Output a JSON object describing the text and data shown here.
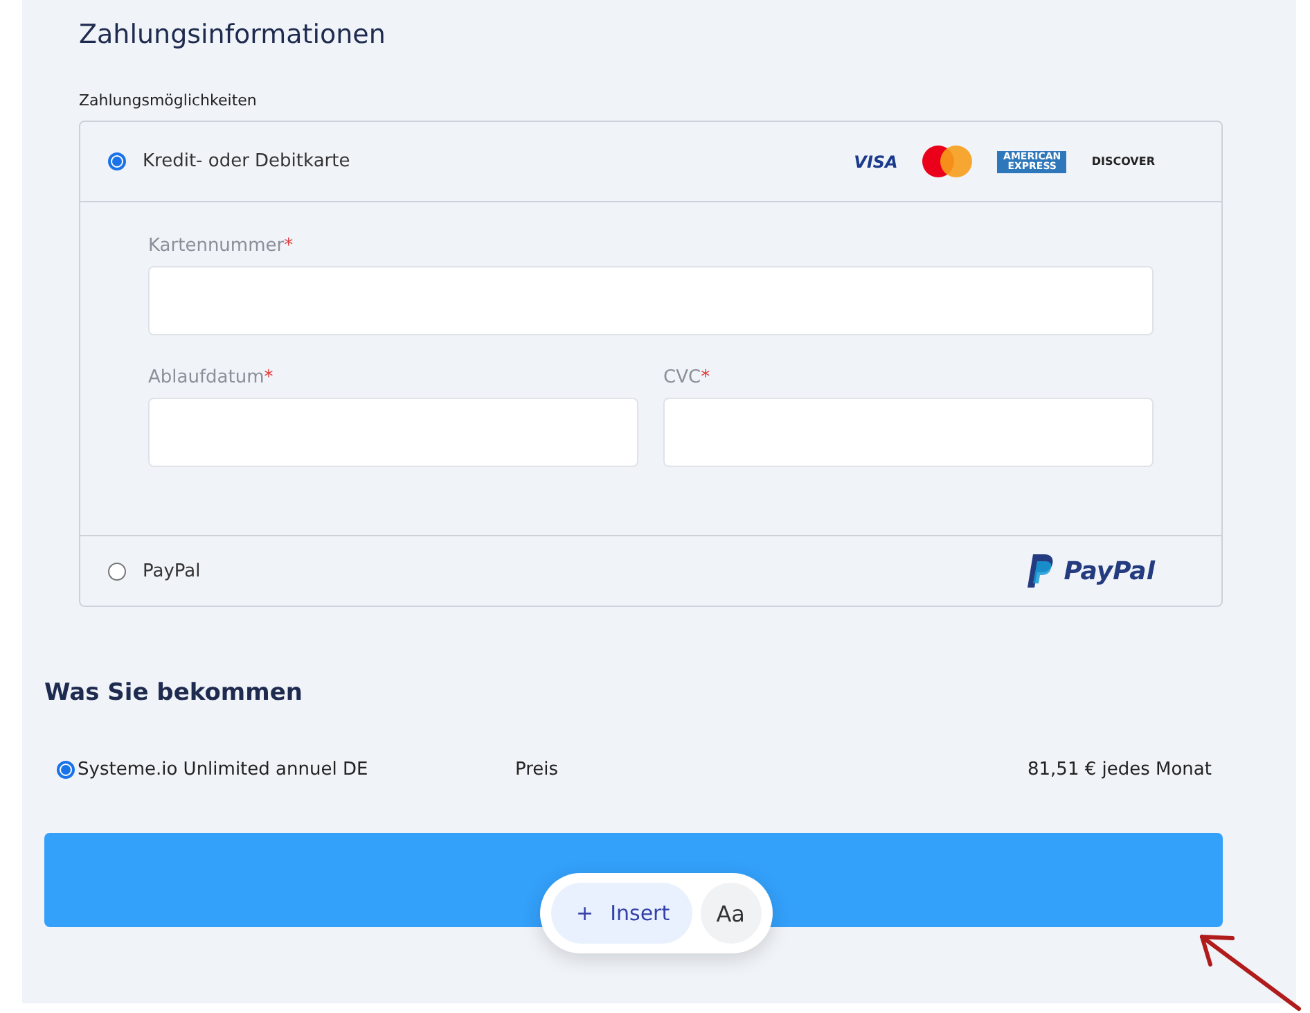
{
  "title": "Zahlungsinformationen",
  "payment_options_label": "Zahlungsmöglichkeiten",
  "payment_methods": [
    {
      "kind": "card",
      "label": "Kredit- oder Debitkarte",
      "selected": true,
      "logos": [
        {
          "kind": "visa",
          "text": "VISA"
        },
        {
          "kind": "mastercard"
        },
        {
          "kind": "amex",
          "text": "AMERICAN EXPRESS"
        },
        {
          "kind": "discover",
          "text": "DISCOVER"
        }
      ],
      "fields": [
        {
          "label": "Kartennummer",
          "required_mark": "*",
          "kind": "wide"
        },
        {
          "label": "Ablaufdatum",
          "required_mark": "*",
          "kind": "narrow"
        },
        {
          "label": "CVC",
          "required_mark": "*",
          "kind": "narrow"
        }
      ]
    },
    {
      "kind": "paypal",
      "label": "PayPal",
      "selected": false,
      "logos": [
        {
          "kind": "paypal",
          "text": "PayPal"
        }
      ]
    }
  ],
  "summary": {
    "heading": "Was Sie bekommen",
    "product": {
      "name": "Systeme.io Unlimited annuel DE",
      "selected": true,
      "price_label": "Preis",
      "price": "81,51 € jedes Monat"
    }
  },
  "floating_toolbar": {
    "insert": {
      "icon": "+",
      "label": "Insert"
    },
    "text_style": "Aa"
  }
}
